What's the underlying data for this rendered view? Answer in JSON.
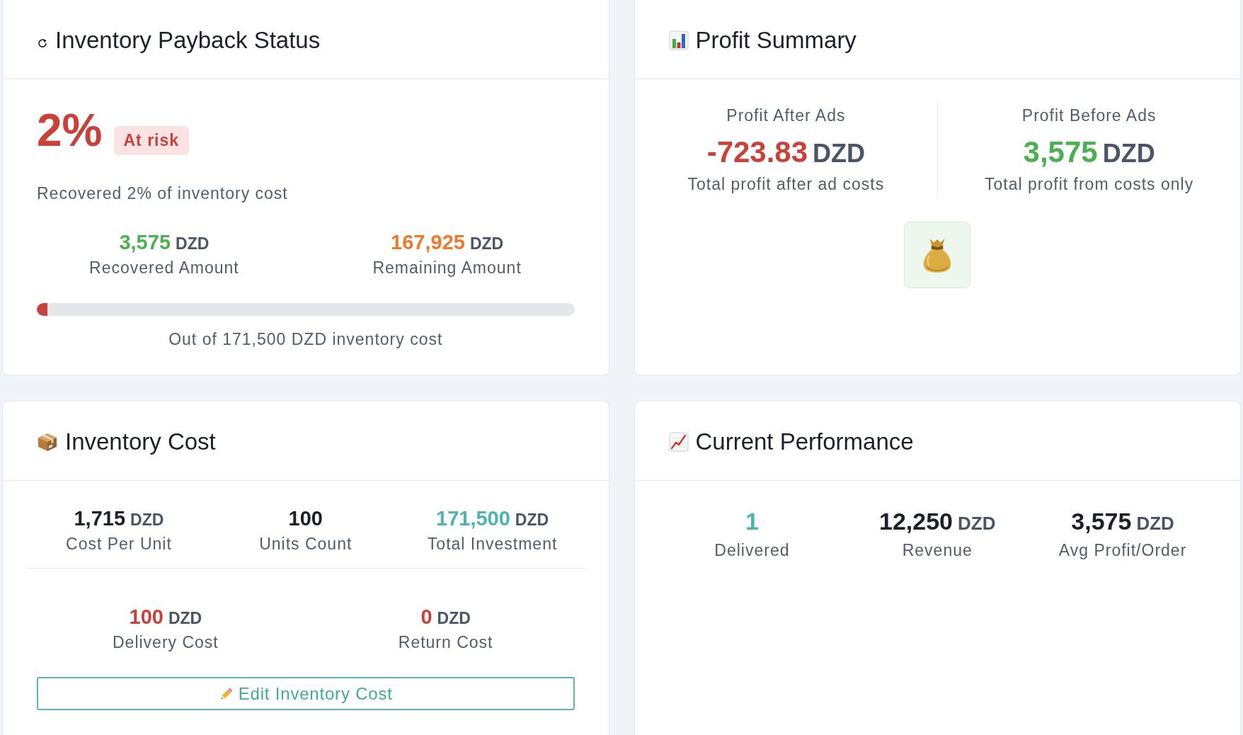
{
  "cards": [
    {
      "kind": "payback",
      "title": "Inventory Payback Status",
      "percent": "2%",
      "at_risk": true,
      "badge": "At risk",
      "summary": "Recovered 2% of inventory cost",
      "amounts": [
        {
          "value": "3,575",
          "unit": "DZD",
          "label": "Recovered Amount",
          "color": "#4caf50"
        },
        {
          "value": "167,925",
          "unit": "DZD",
          "label": "Remaining Amount",
          "color": "#ec7a2c"
        }
      ],
      "progress": {
        "level": 0.02
      },
      "caption": "Out of 171,500 DZD inventory cost"
    },
    {
      "kind": "profit",
      "title": "Profit Summary",
      "columns": [
        {
          "label": "Profit After Ads",
          "value": "-723.83",
          "unit": "DZD",
          "note": "Total profit after ad costs",
          "color": "#c8423b"
        },
        {
          "label": "Profit Before Ads",
          "value": "3,575",
          "unit": "DZD",
          "note": "Total profit from costs only",
          "color": "#4caf50"
        }
      ]
    },
    {
      "kind": "cost",
      "title": "Inventory Cost",
      "stats": [
        {
          "value": "1,715",
          "unit": "DZD",
          "label": "Cost Per Unit",
          "color": "#1a202c"
        },
        {
          "value": "100",
          "label": "Units Count",
          "color": "#1a202c"
        },
        {
          "value": "171,500",
          "unit": "DZD",
          "label": "Total Investment",
          "color": "#4fb3b0"
        }
      ],
      "extra_stats": [
        {
          "value": "100",
          "unit": "DZD",
          "label": "Delivery Cost",
          "color": "#c8423b"
        },
        {
          "value": "0",
          "unit": "DZD",
          "label": "Return Cost",
          "color": "#c8423b"
        }
      ],
      "button": "Edit Inventory Cost"
    },
    {
      "kind": "performance",
      "title": "Current Performance",
      "stats": [
        {
          "value": "1",
          "label": "Delivered",
          "color": "#4fb3b0"
        },
        {
          "value": "12,250",
          "unit": "DZD",
          "label": "Revenue",
          "color": "#1a202c"
        },
        {
          "value": "3,575",
          "unit": "DZD",
          "label": "Avg Profit/Order",
          "color": "#1a202c"
        }
      ]
    }
  ]
}
